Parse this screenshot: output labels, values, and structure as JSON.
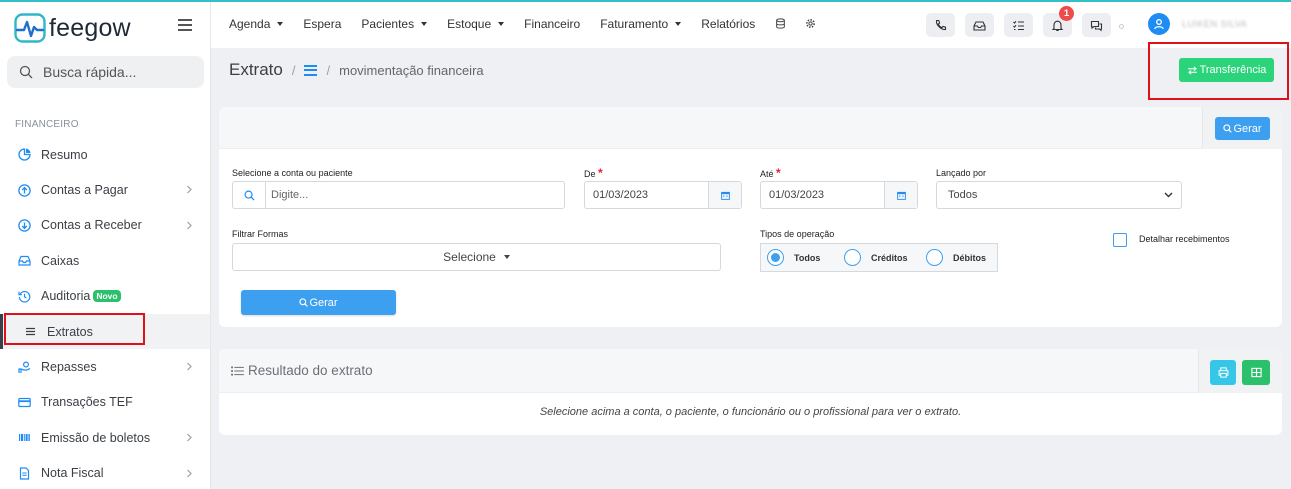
{
  "brand": {
    "name": "feegow",
    "accent": "#2bc06c",
    "primary": "#3d9ff0"
  },
  "search": {
    "placeholder": "Busca rápida..."
  },
  "sidebar": {
    "section": "FINANCEIRO",
    "items": [
      {
        "label": "Resumo",
        "icon": "pie-chart-icon"
      },
      {
        "label": "Contas a Pagar",
        "icon": "arrow-up-circle-icon",
        "chevron": true
      },
      {
        "label": "Contas a Receber",
        "icon": "arrow-down-circle-icon",
        "chevron": true
      },
      {
        "label": "Caixas",
        "icon": "inbox-icon"
      },
      {
        "label": "Auditoria",
        "icon": "history-icon",
        "badge": "Novo"
      },
      {
        "label": "Extratos",
        "icon": "list-icon",
        "active": true
      },
      {
        "label": "Repasses",
        "icon": "hand-money-icon",
        "chevron": true
      },
      {
        "label": "Transações TEF",
        "icon": "credit-card-icon"
      },
      {
        "label": "Emissão de boletos",
        "icon": "barcode-icon",
        "chevron": true
      },
      {
        "label": "Nota Fiscal",
        "icon": "document-icon",
        "chevron": true
      }
    ]
  },
  "topnav": {
    "items": [
      {
        "label": "Agenda",
        "caret": true
      },
      {
        "label": "Espera",
        "caret": false
      },
      {
        "label": "Pacientes",
        "caret": true
      },
      {
        "label": "Estoque",
        "caret": true
      },
      {
        "label": "Financeiro",
        "caret": false
      },
      {
        "label": "Faturamento",
        "caret": true
      },
      {
        "label": "Relatórios",
        "caret": false
      }
    ],
    "notification_count": "1",
    "user_name": "LUIKEN SILVA"
  },
  "header": {
    "title": "Extrato",
    "separator": "/",
    "crumb": "movimentação financeira",
    "transfer_label": "Transferência"
  },
  "filters": {
    "gerar_label": "Gerar",
    "conta": {
      "label": "Selecione a conta ou paciente",
      "placeholder": "Digite..."
    },
    "de": {
      "label": "De",
      "required": "*",
      "value": "01/03/2023"
    },
    "ate": {
      "label": "Até",
      "required": "*",
      "value": "01/03/2023"
    },
    "lancado": {
      "label": "Lançado por",
      "value": "Todos"
    },
    "formas": {
      "label": "Filtrar Formas",
      "value": "Selecione"
    },
    "tipos": {
      "label": "Tipos de operação",
      "options": [
        "Todos",
        "Créditos",
        "Débitos"
      ],
      "selected": "Todos"
    },
    "detalhar": {
      "label": "Detalhar recebimentos",
      "checked": false
    }
  },
  "result": {
    "title": "Resultado do extrato",
    "message": "Selecione acima a conta, o paciente, o funcionário ou o profissional para ver o extrato."
  }
}
